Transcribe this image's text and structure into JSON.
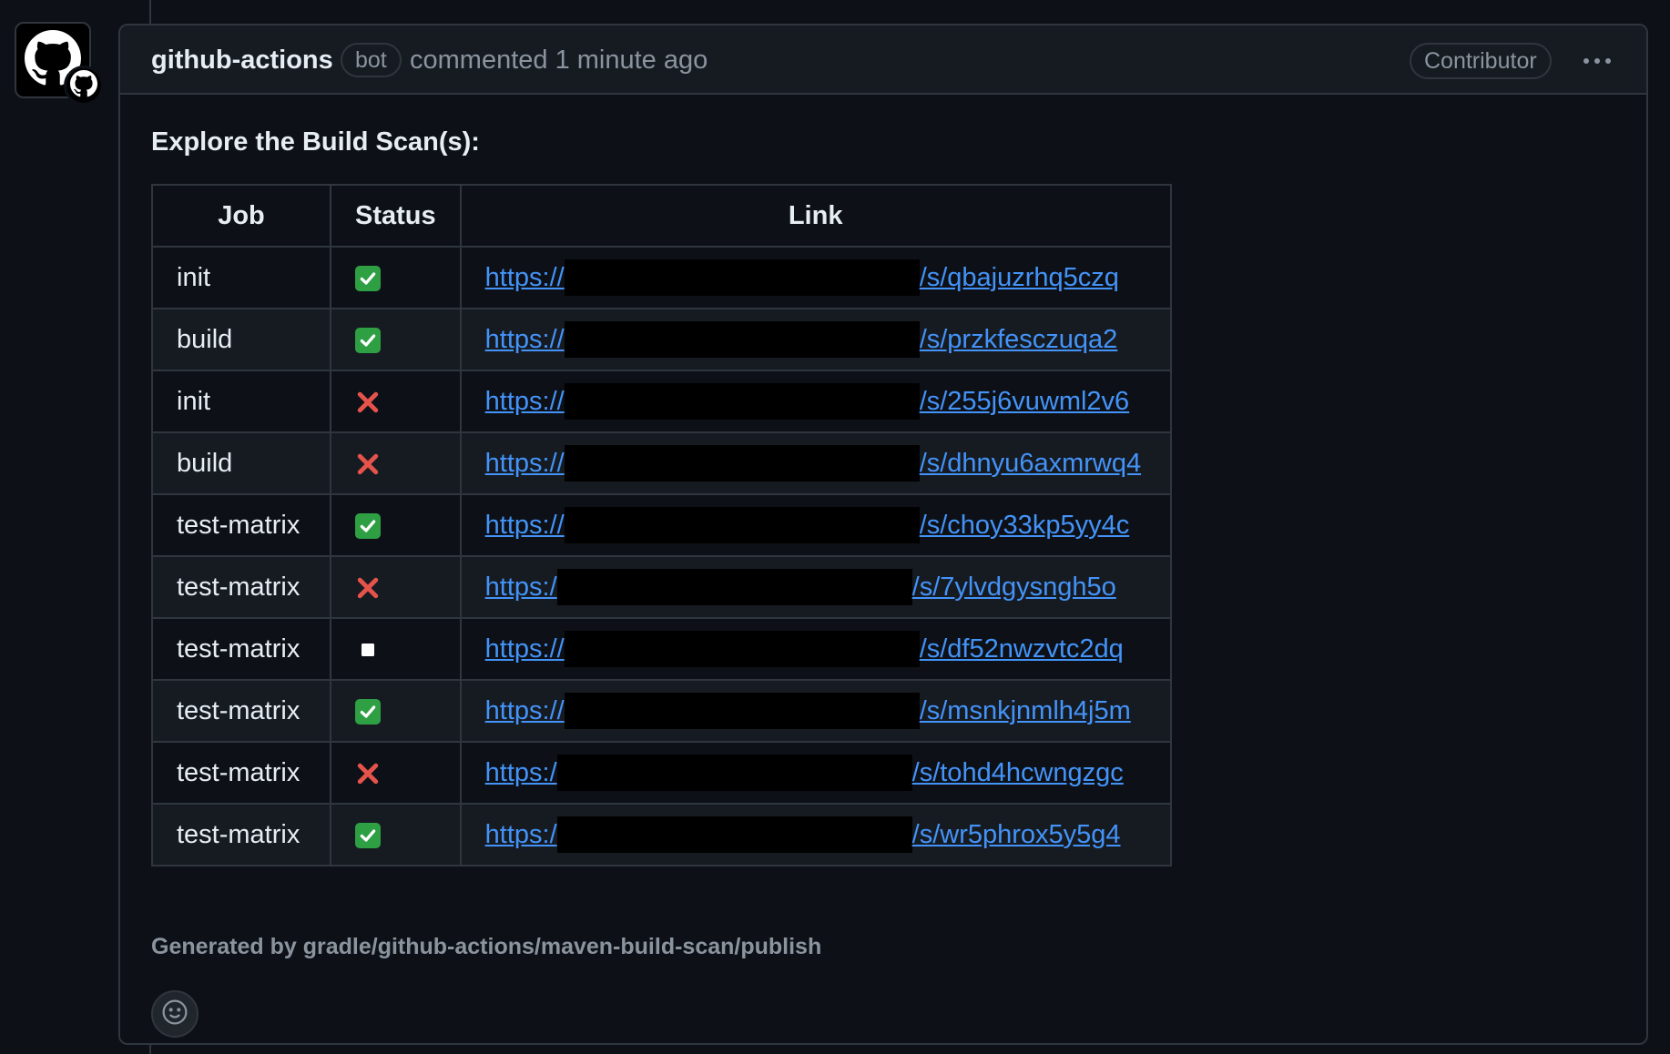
{
  "comment": {
    "author": "github-actions",
    "bot_label": "bot",
    "commented_text": "commented 1 minute ago",
    "contributor_label": "Contributor",
    "heading": "Explore the Build Scan(s):",
    "footer": "Generated by gradle/github-actions/maven-build-scan/publish"
  },
  "table": {
    "headers": [
      "Job",
      "Status",
      "Link"
    ],
    "rows": [
      {
        "job": "init",
        "status": "success",
        "link_prefix": "https://",
        "link_suffix": "/s/qbajuzrhq5czq"
      },
      {
        "job": "build",
        "status": "success",
        "link_prefix": "https://",
        "link_suffix": "/s/przkfesczuqa2"
      },
      {
        "job": "init",
        "status": "failure",
        "link_prefix": "https://",
        "link_suffix": "/s/255j6vuwml2v6"
      },
      {
        "job": "build",
        "status": "failure",
        "link_prefix": "https://",
        "link_suffix": "/s/dhnyu6axmrwq4"
      },
      {
        "job": "test-matrix",
        "status": "success",
        "link_prefix": "https://",
        "link_suffix": "/s/choy33kp5yy4c"
      },
      {
        "job": "test-matrix",
        "status": "failure",
        "link_prefix": "https:/",
        "link_suffix": "/s/7ylvdgysngh5o"
      },
      {
        "job": "test-matrix",
        "status": "skipped",
        "link_prefix": "https://",
        "link_suffix": "/s/df52nwzvtc2dq"
      },
      {
        "job": "test-matrix",
        "status": "success",
        "link_prefix": "https://",
        "link_suffix": "/s/msnkjnmlh4j5m"
      },
      {
        "job": "test-matrix",
        "status": "failure",
        "link_prefix": "https:/",
        "link_suffix": "/s/tohd4hcwngzgc"
      },
      {
        "job": "test-matrix",
        "status": "success",
        "link_prefix": "https:/",
        "link_suffix": "/s/wr5phrox5y5g4"
      }
    ]
  },
  "icons": {
    "avatar": "github-octocat-icon",
    "badge": "github-mark-icon",
    "success": "check-mark-button-icon",
    "failure": "cross-mark-icon",
    "skipped": "white-square-button-icon",
    "menu": "kebab-horizontal-icon",
    "reaction": "smiley-icon"
  },
  "colors": {
    "background": "#0d1117",
    "border": "#30363d",
    "link": "#4493f8",
    "success": "#2ea043",
    "failure": "#e5534b",
    "muted": "#8b949e"
  }
}
